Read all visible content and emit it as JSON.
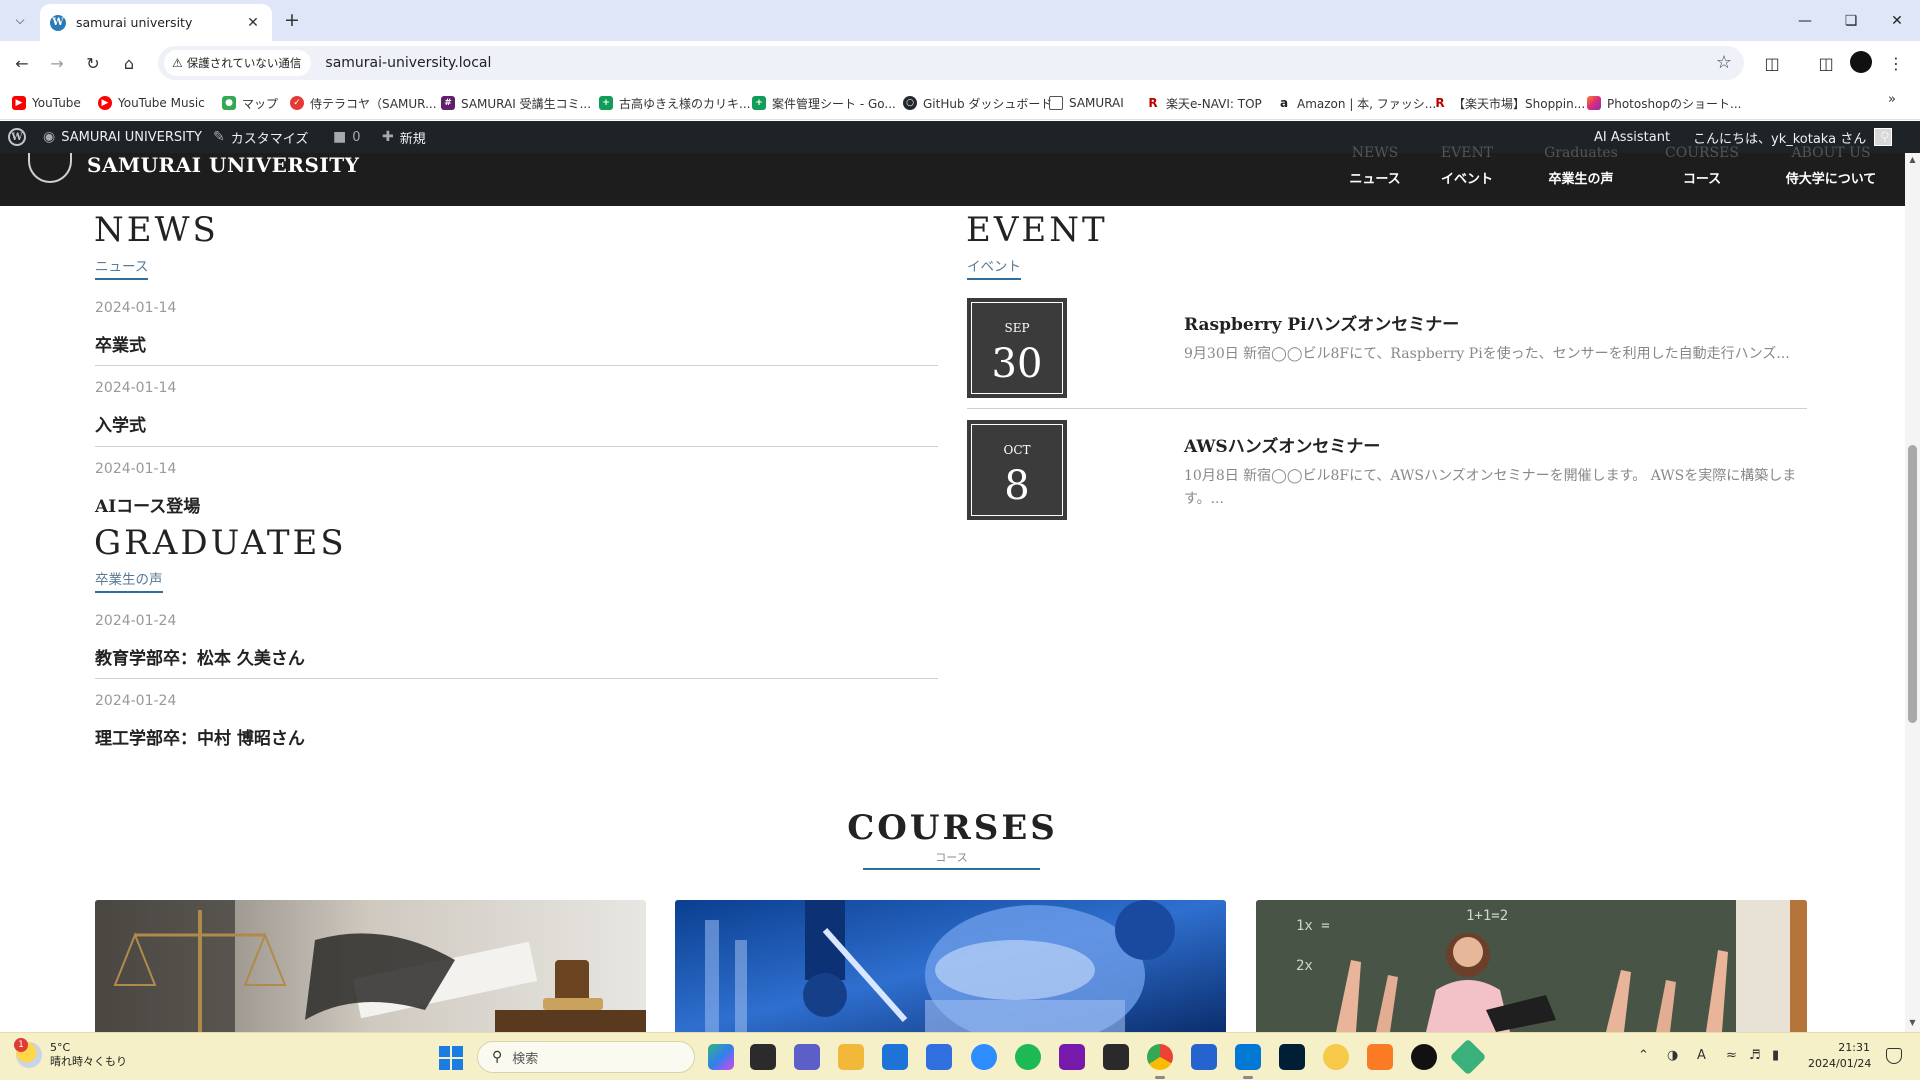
{
  "browser": {
    "tab_title": "samurai university",
    "favicon": "W",
    "new_tab_glyph": "+",
    "security_label": "保護されていない通信",
    "url": "samurai-university.local",
    "bookmarks": [
      {
        "label": "YouTube",
        "icon": "youtube-icon",
        "color": "#ff0000"
      },
      {
        "label": "YouTube Music",
        "icon": "youtube-music-icon",
        "color": "#ff0000"
      },
      {
        "label": "マップ",
        "icon": "maps-icon",
        "color": "#34a853"
      },
      {
        "label": "侍テラコヤ（SAMUR...",
        "icon": "terakoya-icon",
        "color": "#e53935"
      },
      {
        "label": "SAMURAI 受講生コミ...",
        "icon": "slack-icon",
        "color": "#611f69"
      },
      {
        "label": "古高ゆきえ様のカリキ...",
        "icon": "sheets-icon",
        "color": "#0f9d58"
      },
      {
        "label": "案件管理シート - Go...",
        "icon": "sheets-icon",
        "color": "#0f9d58"
      },
      {
        "label": "GitHub ダッシュボード",
        "icon": "github-icon",
        "color": "#24292f"
      },
      {
        "label": "SAMURAI",
        "icon": "folder-icon",
        "color": "#555555"
      },
      {
        "label": "楽天e-NAVI: TOP",
        "icon": "rakuten-icon",
        "color": "#bf0000"
      },
      {
        "label": "Amazon | 本, ファッシ...",
        "icon": "amazon-icon",
        "color": "#ff9900"
      },
      {
        "label": "【楽天市場】Shoppin...",
        "icon": "rakuten-icon",
        "color": "#bf0000"
      },
      {
        "label": "Photoshopのショート...",
        "icon": "photoshop-shortcut-icon",
        "color": "#e3458a"
      }
    ],
    "more_bookmarks": "»"
  },
  "adminbar": {
    "site_name": "SAMURAI UNIVERSITY",
    "customize": "カスタマイズ",
    "comments_count": "0",
    "new_label": "新規",
    "ai_assistant": "AI Assistant",
    "greeting": "こんにちは、yk_kotaka さん"
  },
  "header": {
    "logo": "SAMURAI UNIVERSITY",
    "nav": [
      {
        "en": "NEWS",
        "ja": "ニュース"
      },
      {
        "en": "EVENT",
        "ja": "イベント"
      },
      {
        "en": "Graduates",
        "ja": "卒業生の声"
      },
      {
        "en": "COURSES",
        "ja": "コース"
      },
      {
        "en": "ABOUT US",
        "ja": "侍大学について"
      }
    ]
  },
  "news": {
    "title": "NEWS",
    "subtitle": "ニュース",
    "items": [
      {
        "date": "2024-01-14",
        "title": "卒業式"
      },
      {
        "date": "2024-01-14",
        "title": "入学式"
      },
      {
        "date": "2024-01-14",
        "title": "AIコース登場"
      }
    ]
  },
  "graduates": {
    "title": "GRADUATES",
    "subtitle": "卒業生の声",
    "items": [
      {
        "date": "2024-01-24",
        "title": "教育学部卒：松本 久美さん"
      },
      {
        "date": "2024-01-24",
        "title": "理工学部卒：中村 博昭さん"
      }
    ]
  },
  "event": {
    "title": "EVENT",
    "subtitle": "イベント",
    "items": [
      {
        "month": "SEP",
        "day": "30",
        "title": "Raspberry Piハンズオンセミナー",
        "desc": "9月30日 新宿◯◯ビル8Fにて、Raspberry Piを使った、センサーを利用した自動走行ハンズ..."
      },
      {
        "month": "OCT",
        "day": "8",
        "title": "AWSハンズオンセミナー",
        "desc": "10月8日 新宿◯◯ビル8Fにて、AWSハンズオンセミナーを開催します。 AWSを実際に構築します。..."
      }
    ]
  },
  "courses": {
    "title": "COURSES",
    "subtitle": "コース",
    "cards": [
      {
        "image": "law-scales-gavel-photo"
      },
      {
        "image": "science-lab-photo"
      },
      {
        "image": "teacher-classroom-photo"
      }
    ]
  },
  "taskbar": {
    "weather_temp": "5°C",
    "weather_desc": "晴れ時々くもり",
    "weather_badge": "1",
    "search_placeholder": "検索",
    "time": "21:31",
    "date": "2024/01/24",
    "ime": "A"
  }
}
